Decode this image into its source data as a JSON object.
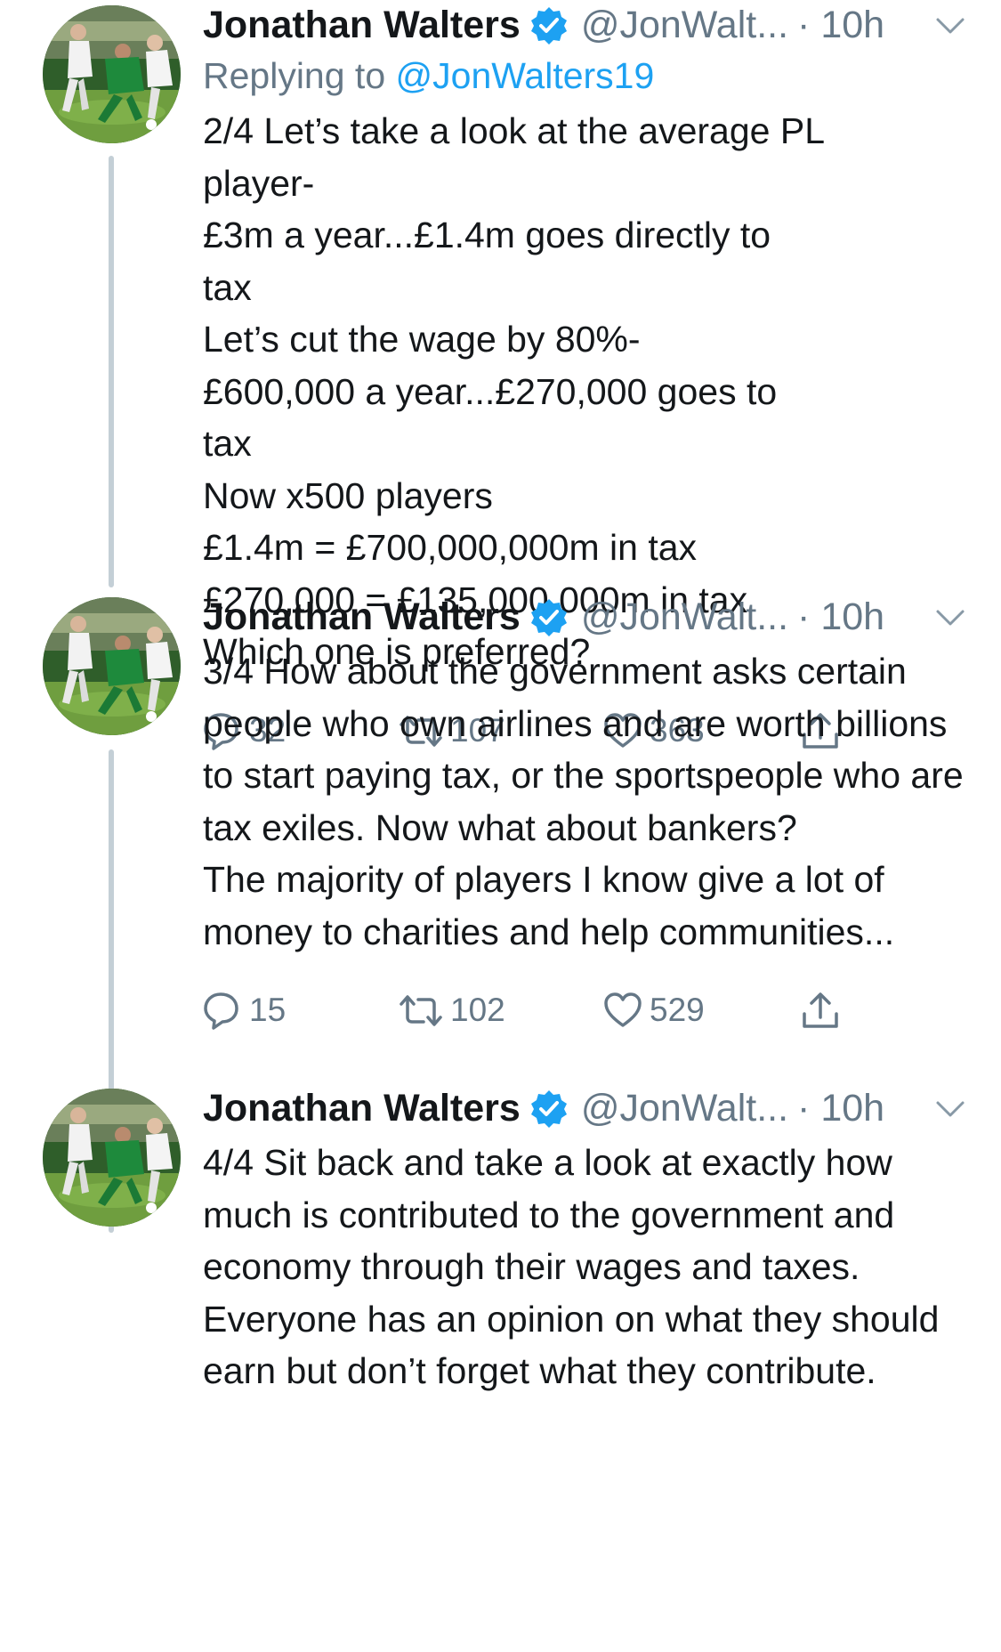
{
  "tweets": [
    {
      "name": "Jonathan Walters",
      "handle": "@JonWalt...",
      "time": "· 10h",
      "replying_prefix": "Replying to ",
      "replying_to": "@JonWalters19",
      "text": "2/4 Let’s take a look at the average PL player-\n£3m a year...£1.4m goes directly to tax\nLet’s cut the wage by 80%-\n£600,000 a year...£270,000 goes to tax\nNow x500 players\n£1.4m = £700,000,000m in tax\n£270,000 = £135,000,000m in tax\nWhich one is preferred?",
      "replies": "32",
      "retweets": "107",
      "likes": "363"
    },
    {
      "name": "Jonathan Walters",
      "handle": "@JonWalt...",
      "time": "· 10h",
      "text": "3/4 How about the government asks certain people who own airlines and are worth billions to start paying tax, or the sportspeople who are tax exiles. Now what about bankers?\nThe majority of players I know give a lot of money to charities and help communities...",
      "replies": "15",
      "retweets": "102",
      "likes": "529"
    },
    {
      "name": "Jonathan Walters",
      "handle": "@JonWalt...",
      "time": "· 10h",
      "text": "4/4 Sit back and take a look at exactly how much is contributed to the government and economy through their wages and taxes. Everyone has an opinion on what they should earn but don’t forget what they contribute."
    }
  ],
  "icons": {
    "avatar": "football-player-photo",
    "verified": "verified-badge-icon",
    "caret": "chevron-down-icon",
    "reply": "reply-icon",
    "retweet": "retweet-icon",
    "like": "heart-icon",
    "share": "share-icon"
  },
  "colors": {
    "verified": "#1da1f2",
    "muted": "#657786",
    "link": "#1da1f2",
    "thread_line": "#c4cfd6"
  }
}
